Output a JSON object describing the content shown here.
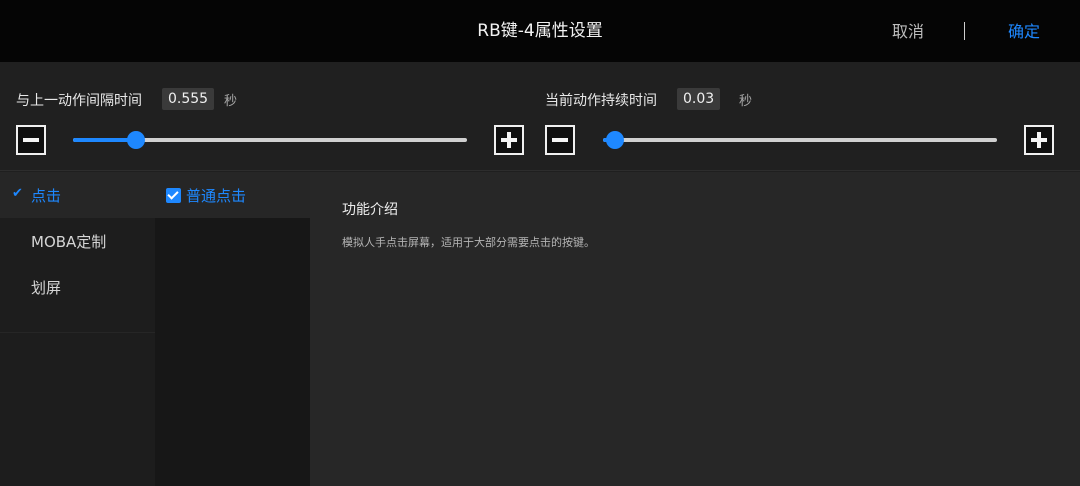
{
  "header": {
    "title": "RB键-4属性设置",
    "cancel_label": "取消",
    "confirm_label": "确定"
  },
  "sliders": [
    {
      "label": "与上一动作间隔时间",
      "value": "0.555",
      "unit": "秒",
      "level": 0.16,
      "minus_icon": "minus-icon",
      "plus_icon": "plus-icon"
    },
    {
      "label": "当前动作持续时间",
      "value": "0.03",
      "unit": "秒",
      "level": 0.03,
      "minus_icon": "minus-icon",
      "plus_icon": "plus-icon"
    }
  ],
  "categories": [
    {
      "label": "点击",
      "selected": true
    },
    {
      "label": "MOBA定制",
      "selected": false
    },
    {
      "label": "划屏",
      "selected": false
    }
  ],
  "sub_options": [
    {
      "label": "普通点击",
      "checked": true
    }
  ],
  "description": {
    "title": "功能介绍",
    "text": "模拟人手点击屏幕，适用于大部分需要点击的按键。"
  },
  "colors": {
    "accent": "#1e88ff",
    "background": "#1f1f1f",
    "topbar": "#050505"
  }
}
